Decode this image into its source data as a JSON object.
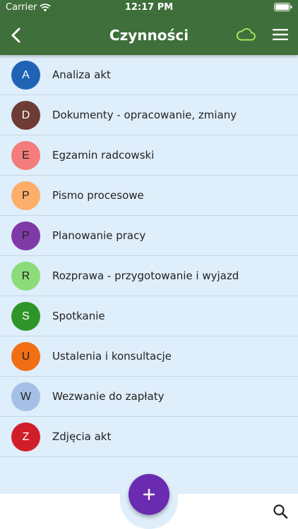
{
  "status_bar": {
    "carrier": "Carrier",
    "time": "12:17 PM"
  },
  "nav_bar": {
    "title": "Czynności",
    "icons": {
      "back": "chevron-left-icon",
      "cloud": "cloud-icon",
      "menu": "hamburger-menu-icon"
    }
  },
  "list": {
    "items": [
      {
        "letter": "A",
        "label": "Analiza akt",
        "color": "#2063b5",
        "text_color": "#ffffff"
      },
      {
        "letter": "D",
        "label": "Dokumenty - opracowanie, zmiany",
        "color": "#6e3c35",
        "text_color": "#ffffff"
      },
      {
        "letter": "E",
        "label": "Egzamin radcowski",
        "color": "#f47c7c",
        "text_color": "#222222"
      },
      {
        "letter": "P",
        "label": "Pismo procesowe",
        "color": "#fcae6a",
        "text_color": "#222222"
      },
      {
        "letter": "P",
        "label": "Planowanie pracy",
        "color": "#7f3aa8",
        "text_color": "#222222"
      },
      {
        "letter": "R",
        "label": "Rozprawa - przygotowanie i wyjazd",
        "color": "#8cdc7a",
        "text_color": "#222222"
      },
      {
        "letter": "S",
        "label": "Spotkanie",
        "color": "#2e9628",
        "text_color": "#ffffff"
      },
      {
        "letter": "U",
        "label": "Ustalenia i konsultacje",
        "color": "#f26e14",
        "text_color": "#222222"
      },
      {
        "letter": "W",
        "label": "Wezwanie do zapłaty",
        "color": "#a5c0e6",
        "text_color": "#222222"
      },
      {
        "letter": "Z",
        "label": "Zdjęcia akt",
        "color": "#d11f2a",
        "text_color": "#ffffff"
      }
    ]
  },
  "fab": {
    "icon": "plus-icon",
    "color": "#6a2bb0"
  },
  "bottom_bar": {
    "search_icon": "search-icon"
  },
  "colors": {
    "header": "#3f6f3a",
    "list_background": "#dfeefb",
    "cloud_accent": "#a6e35a"
  }
}
